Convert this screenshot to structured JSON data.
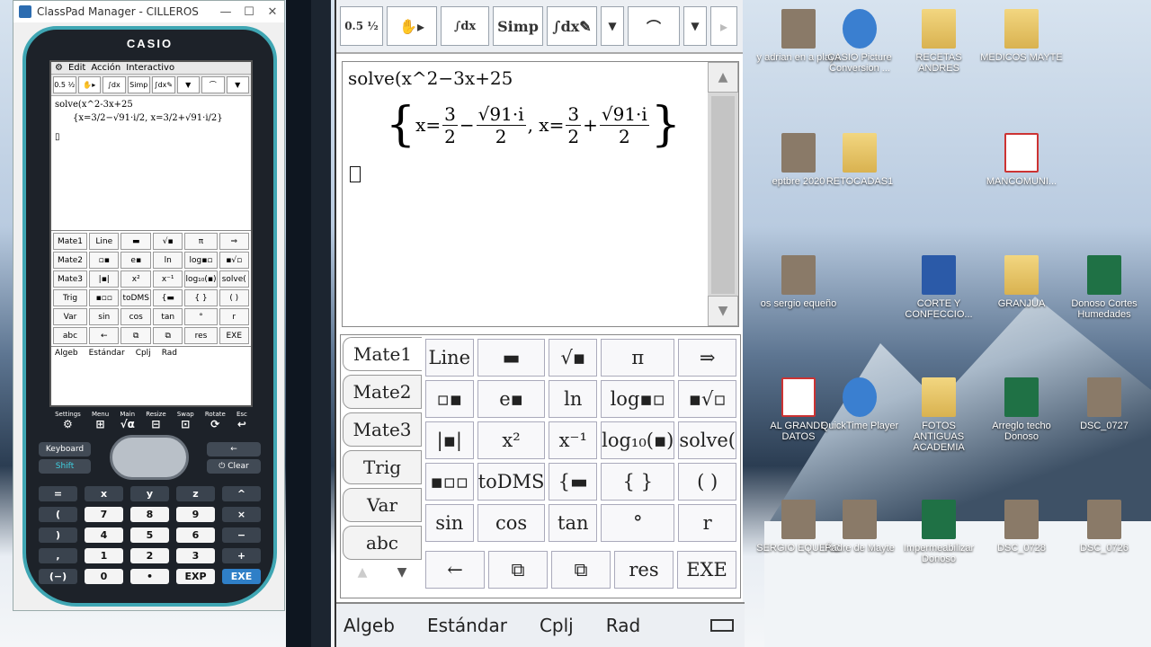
{
  "window": {
    "title": "ClassPad Manager - CILLEROS"
  },
  "calculator": {
    "brand": "CASIO",
    "mini_menu": [
      "Edit",
      "Acción",
      "Interactivo"
    ],
    "mini_input": "solve(x^2-3x+25",
    "mini_side_tabs": [
      "Mate1",
      "Mate2",
      "Mate3",
      "Trig",
      "Var",
      "abc"
    ],
    "mini_status": [
      "Algeb",
      "Estándar",
      "Cplj",
      "Rad"
    ],
    "bottom_icons": [
      "Settings",
      "Menu",
      "Main",
      "Resize",
      "Swap",
      "Rotate",
      "Esc"
    ],
    "keyboard_label": "Keyboard",
    "shift_label": "Shift",
    "clear_label": "Clear",
    "keypad": [
      "=",
      "x",
      "y",
      "z",
      "^",
      "÷",
      "(",
      "7",
      "8",
      "9",
      "×",
      ")",
      "4",
      "5",
      "6",
      "−",
      ",",
      "1",
      "2",
      "3",
      "+",
      "(−)",
      "0",
      "•",
      "EXP",
      "EXE"
    ]
  },
  "main": {
    "toolbar": [
      "0.5 ½",
      "✋▸",
      "∫dx",
      "Simp",
      "∫dx✎",
      "▼",
      "⌒",
      "▼",
      "▸"
    ],
    "input": "solve(x^2−3x+25",
    "result": {
      "num1": "3",
      "den": "2",
      "sqrt": "√91·i",
      "op_minus": "−",
      "op_plus": "+"
    },
    "tabs": [
      "Mate1",
      "Mate2",
      "Mate3",
      "Trig",
      "Var",
      "abc"
    ],
    "keys": [
      "Line",
      "▬",
      "√▪",
      "π",
      "⇒",
      "▫▪",
      "e▪",
      "ln",
      "log▪▫",
      "▪√▫",
      "|▪|",
      "x²",
      "x⁻¹",
      "log₁₀(▪)",
      "solve(",
      "▪▫▫",
      "toDMS",
      "{▬",
      "{ }",
      "( )",
      "sin",
      "cos",
      "tan",
      "°",
      "r"
    ],
    "bottom_keys": [
      "←",
      "⧉",
      "⧉",
      "res",
      "EXE"
    ],
    "status": [
      "Algeb",
      "Estándar",
      "Cplj",
      "Rad"
    ]
  },
  "desktop": {
    "icons": [
      {
        "label": "y adrian en a playa",
        "kind": "photo"
      },
      {
        "label": "CASIO Picture Conversion ...",
        "kind": "qt"
      },
      {
        "label": "RECETAS ANDRES",
        "kind": "folder"
      },
      {
        "label": "MEDICOS MAYTE",
        "kind": "folder"
      },
      {
        "label": "eptbre 2020",
        "kind": "photo"
      },
      {
        "label": "RETOCADAS1",
        "kind": "folder"
      },
      {
        "label": "MANCOMUNI...",
        "kind": "pdf"
      },
      {
        "label": "os sergio equeño",
        "kind": "photo"
      },
      {
        "label": "CORTE Y CONFECCIO...",
        "kind": "word"
      },
      {
        "label": "GRANJUA",
        "kind": "folder"
      },
      {
        "label": "Donoso Cortes Humedades",
        "kind": "excel"
      },
      {
        "label": "AL GRANDE DATOS",
        "kind": "pdf"
      },
      {
        "label": "QuickTime Player",
        "kind": "qt"
      },
      {
        "label": "FOTOS ANTIGUAS ACADEMIA",
        "kind": "folder"
      },
      {
        "label": "Arreglo techo Donoso",
        "kind": "excel"
      },
      {
        "label": "DSC_0727",
        "kind": "photo"
      },
      {
        "label": "SERGIO EQUEÑO",
        "kind": "photo"
      },
      {
        "label": "Padre de Mayte",
        "kind": "photo"
      },
      {
        "label": "Impermeabilizar Donoso",
        "kind": "excel"
      },
      {
        "label": "DSC_0728",
        "kind": "photo"
      },
      {
        "label": "DSC_0726",
        "kind": "photo"
      }
    ]
  }
}
